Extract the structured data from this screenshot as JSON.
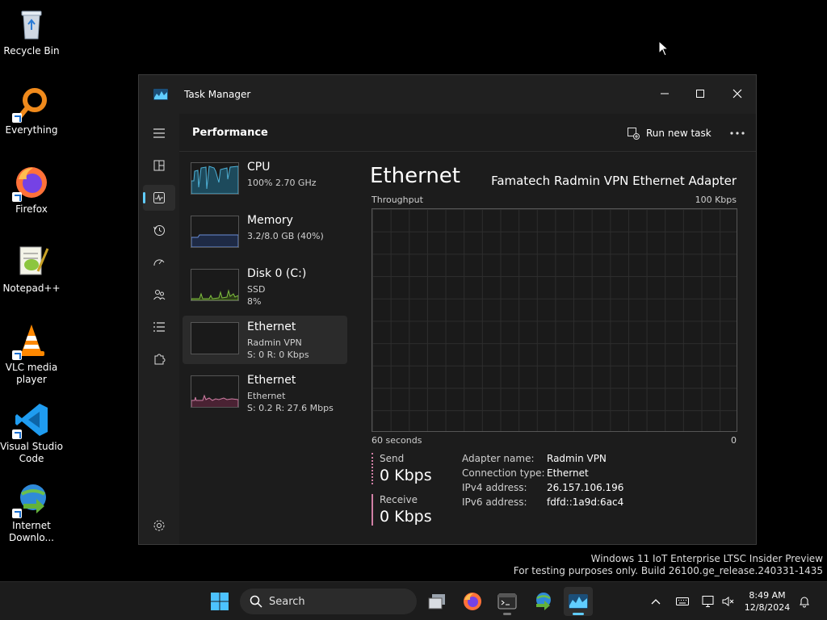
{
  "desktop": {
    "icons": [
      {
        "label": "Recycle Bin"
      },
      {
        "label": "Everything"
      },
      {
        "label": "Firefox"
      },
      {
        "label": "Notepad++"
      },
      {
        "label": "VLC media player"
      },
      {
        "label": "Visual Studio Code"
      },
      {
        "label": "Internet Downlo..."
      }
    ],
    "watermark": {
      "line1": "Windows 11 IoT Enterprise LTSC Insider Preview",
      "line2": "For testing purposes only. Build 26100.ge_release.240331-1435"
    }
  },
  "window": {
    "title": "Task Manager",
    "page_title": "Performance",
    "run_new_task": "Run new task",
    "resources": [
      {
        "name": "CPU",
        "sub1": "100% 2.70 GHz",
        "sub2": "",
        "color": "#4fb3d9"
      },
      {
        "name": "Memory",
        "sub1": "3.2/8.0 GB (40%)",
        "sub2": "",
        "color": "#6a8fd8"
      },
      {
        "name": "Disk 0 (C:)",
        "sub1": "SSD",
        "sub2": "8%",
        "color": "#7fbf3f"
      },
      {
        "name": "Ethernet",
        "sub1": "Radmin VPN",
        "sub2": "S: 0 R: 0 Kbps",
        "color": "#d07fa5"
      },
      {
        "name": "Ethernet",
        "sub1": "Ethernet",
        "sub2": "S: 0.2 R: 27.6 Mbps",
        "color": "#d07fa5"
      }
    ],
    "detail": {
      "title": "Ethernet",
      "adapter": "Famatech Radmin VPN Ethernet Adapter",
      "throughput_label": "Throughput",
      "scale_max": "100 Kbps",
      "time_label": "60 seconds",
      "zero_label": "0",
      "send_label": "Send",
      "send_value": "0 Kbps",
      "receive_label": "Receive",
      "receive_value": "0 Kbps",
      "properties": [
        {
          "key": "Adapter name:",
          "value": "Radmin VPN"
        },
        {
          "key": "Connection type:",
          "value": "Ethernet"
        },
        {
          "key": "IPv4 address:",
          "value": "26.157.106.196"
        },
        {
          "key": "IPv6 address:",
          "value": "fdfd::1a9d:6ac4"
        }
      ]
    }
  },
  "taskbar": {
    "search_placeholder": "Search",
    "time": "8:49 AM",
    "date": "12/8/2024"
  },
  "colors": {
    "accent": "#60cdff",
    "ethernet_graph": "#d07fa5"
  }
}
